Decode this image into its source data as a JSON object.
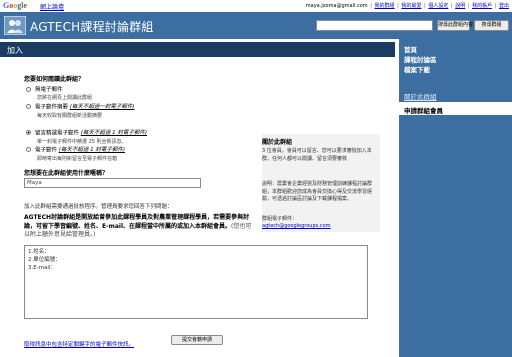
{
  "topbar": {
    "logo": {
      "g": "G",
      "o1": "o",
      "o2": "o",
      "gl": "g",
      "l": "l",
      "e": "e"
    },
    "product": "網上論壇",
    "email": "maya.jxoma@gmail.com",
    "links": [
      "我的群組",
      "我的最愛",
      "個人設定",
      "說明",
      "我的帳戶",
      "登出"
    ]
  },
  "header": {
    "title": "AGTECH課程討論群組",
    "search_placeholder": "",
    "search_group_button": "搜尋此群組內容",
    "search_groups_button": "搜尋群組"
  },
  "join": {
    "title": "加入"
  },
  "form": {
    "q1": "您要如何閱讀此群組？",
    "options": [
      {
        "label": "無電子郵件",
        "italic": "",
        "sub": "您將在網頁上閱讀此群組",
        "checked": false
      },
      {
        "label": "電子郵件摘要 ",
        "italic": "(每天不超過一封電子郵件)",
        "sub": "每天收取有關群組新活動摘要",
        "checked": false
      },
      {
        "label": "留言精選電子郵件 ",
        "italic": "(每天不超過 1 封電子郵件)",
        "sub": "單一封電子郵件中精選 25 則全新訊息。",
        "checked": true
      },
      {
        "label": "電子郵件 ",
        "italic": "(每天不超過 1 封電子郵件)",
        "sub": "即時寄出每則新留言至電子郵件信箱",
        "checked": false
      }
    ],
    "q2": "您想要在此群組使用什麼暱稱？",
    "nickname": "Maya",
    "join_note": "加入此群組需要通過批核程序。管理員要求您回答下列問題：",
    "q3": "AGTECH討論群組是開放給曾參加此課程學員及對農業管理課程學員，若需要參與討論，可留下學習編號、姓名、E-mail、在課程當中所屬的或加入本群組會員。",
    "q3_note": "(您也可以附上額外意見給管理員。)",
    "answer_lines": [
      "1.姓名：",
      "2.單位編號：",
      "3.E-mail："
    ],
    "submit": "提交會籍申請",
    "bottom_link": "取得訊息中包含特定關鍵字的電子郵件快訊。"
  },
  "info": {
    "head": "關於此群組",
    "body1": "3 位會員。會員可以留言、您可以要求審批加入本群。任何人都可以閱讀、留言須要審核",
    "body2": "說明：農業會企業經營及財務管理訓練課程討論群組，本群組歡迎您成為會員交換心得及交流學習經驗，可透過討論區討論及下載課程檔案。",
    "email_label": "群組電子郵件：",
    "email": "agtech@googlegroups.com"
  },
  "sidebar": {
    "home": "首頁",
    "forum": "課程討論區",
    "files": "檔案下載",
    "about": "關於此群組",
    "active": "申請群組會員"
  },
  "colors": {
    "header": "#3c6ea1",
    "join_bar": "#1a3c63",
    "link": "#0000cc"
  }
}
